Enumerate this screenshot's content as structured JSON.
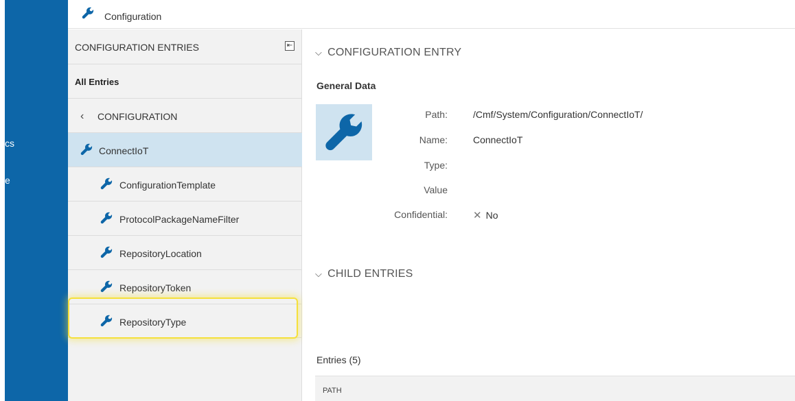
{
  "topbar": {
    "title": "Configuration",
    "icon": "wrench-icon"
  },
  "sidebar_fragments": {
    "a": "cs",
    "b": "e"
  },
  "entries_panel": {
    "header": "CONFIGURATION ENTRIES",
    "all_entries": "All Entries",
    "back_label": "CONFIGURATION",
    "selected": "ConnectIoT",
    "children": [
      "ConfigurationTemplate",
      "ProtocolPackageNameFilter",
      "RepositoryLocation",
      "RepositoryToken",
      "RepositoryType"
    ]
  },
  "main": {
    "section_entry": "CONFIGURATION ENTRY",
    "general_title": "General Data",
    "fields": {
      "path_label": "Path:",
      "path_value": "/Cmf/System/Configuration/ConnectIoT/",
      "name_label": "Name:",
      "name_value": "ConnectIoT",
      "type_label": "Type:",
      "type_value": "",
      "value_label": "Value",
      "value_value": "",
      "confidential_label": "Confidential:",
      "confidential_value": "No"
    },
    "section_child": "CHILD ENTRIES",
    "entries_count": "Entries (5)",
    "table_column_path": "PATH"
  },
  "colors": {
    "brand_blue": "#0d66a8",
    "selected_row": "#cfe3f0",
    "highlight": "#f5e03a",
    "wrench": "#0d66a8"
  }
}
